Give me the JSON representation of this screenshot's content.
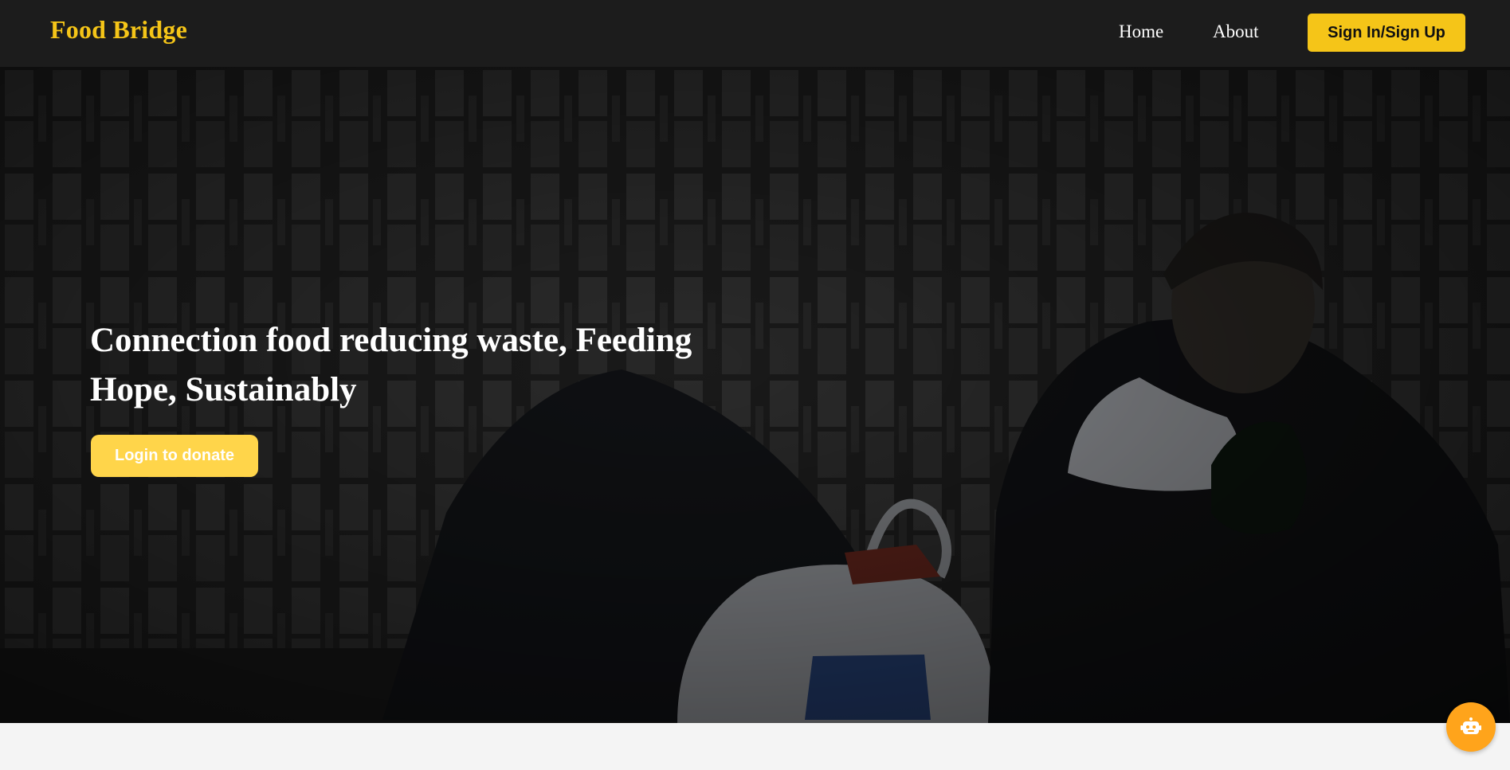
{
  "navbar": {
    "brand": "Food Bridge",
    "links": [
      {
        "label": "Home"
      },
      {
        "label": "About"
      }
    ],
    "signin_label": "Sign In/Sign Up"
  },
  "hero": {
    "title": "Connection food reducing waste, Feeding Hope, Sustainably",
    "cta_label": "Login to donate",
    "background_icon": "photo-man-eating-by-brick-wall"
  },
  "chat": {
    "icon": "robot-icon"
  },
  "colors": {
    "navbar_bg": "#1c1c1c",
    "accent_yellow": "#f5c518",
    "cta_yellow": "#ffd54a",
    "chat_orange": "#ffa41b",
    "page_bg": "#f4f4f4"
  }
}
